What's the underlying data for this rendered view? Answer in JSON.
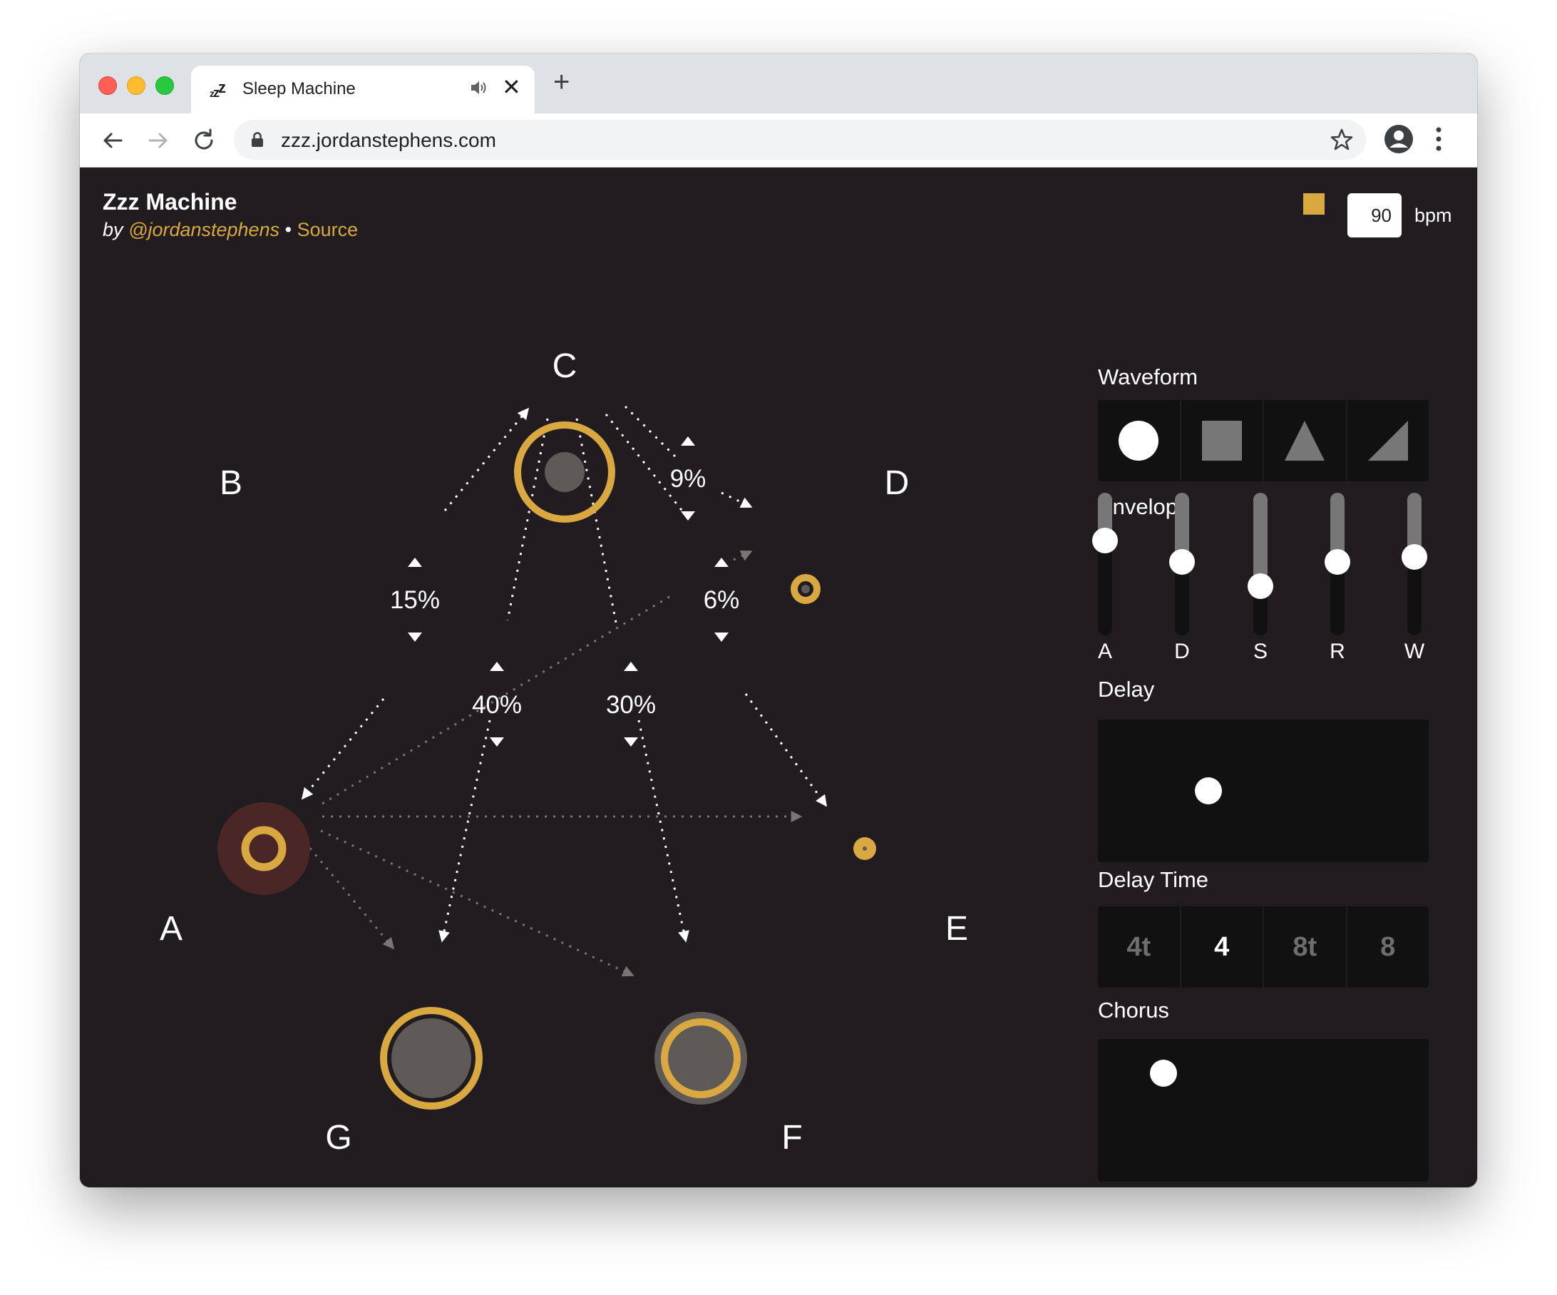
{
  "browser": {
    "tab_title": "Sleep Machine",
    "tab_favicon": "zzz-icon",
    "url": "zzz.jordanstephens.com"
  },
  "header": {
    "title": "Zzz Machine",
    "by": "by",
    "author": "@jordanstephens",
    "separator": "•",
    "source": "Source",
    "bpm_value": "90",
    "bpm_label": "bpm"
  },
  "graph": {
    "nodes": [
      "C",
      "B",
      "D",
      "A",
      "E",
      "G",
      "F"
    ],
    "probabilities": [
      "9%",
      "15%",
      "6%",
      "40%",
      "30%"
    ]
  },
  "panel": {
    "waveform_label": "Waveform",
    "waveforms": [
      "sine-icon",
      "square-icon",
      "triangle-icon",
      "sawtooth-icon"
    ],
    "envelope_label": "Envelope",
    "envelope": [
      {
        "label": "A",
        "value": 0.7
      },
      {
        "label": "D",
        "value": 0.52
      },
      {
        "label": "S",
        "value": 0.31
      },
      {
        "label": "R",
        "value": 0.52
      },
      {
        "label": "W",
        "value": 0.56
      }
    ],
    "delay_label": "Delay",
    "delay_time_label": "Delay Time",
    "delay_times": [
      {
        "label": "4t",
        "active": false
      },
      {
        "label": "4",
        "active": true
      },
      {
        "label": "8t",
        "active": false
      },
      {
        "label": "8",
        "active": false
      }
    ],
    "chorus_label": "Chorus"
  },
  "colors": {
    "accent": "#d9a840",
    "background": "#201c1f",
    "panel": "#111111",
    "node_fill": "#5d5a57",
    "node_a_fill": "#4a2626"
  }
}
